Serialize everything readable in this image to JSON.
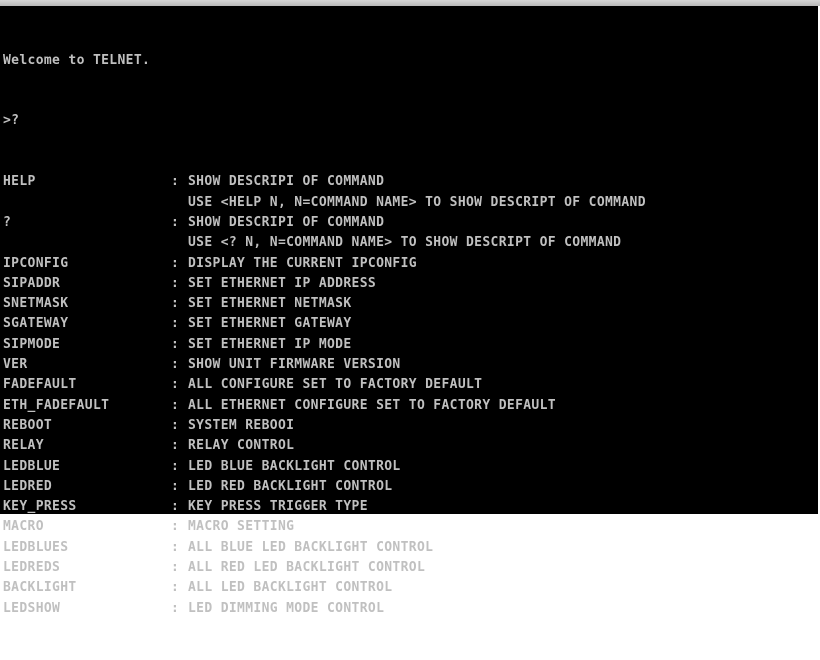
{
  "terminal": {
    "banner": "Welcome to TELNET.",
    "prompt": ">?",
    "separator": ":",
    "commands": [
      {
        "name": "HELP",
        "desc": "SHOW DESCRIPI OF COMMAND"
      },
      {
        "name": "",
        "desc": "USE <HELP N, N=COMMAND NAME> TO SHOW DESCRIPT OF COMMAND"
      },
      {
        "name": "?",
        "desc": "SHOW DESCRIPI OF COMMAND"
      },
      {
        "name": "",
        "desc": "USE <? N, N=COMMAND NAME> TO SHOW DESCRIPT OF COMMAND"
      },
      {
        "name": "IPCONFIG",
        "desc": "DISPLAY THE CURRENT IPCONFIG"
      },
      {
        "name": "SIPADDR",
        "desc": "SET ETHERNET IP ADDRESS"
      },
      {
        "name": "SNETMASK",
        "desc": "SET ETHERNET NETMASK"
      },
      {
        "name": "SGATEWAY",
        "desc": "SET ETHERNET GATEWAY"
      },
      {
        "name": "SIPMODE",
        "desc": "SET ETHERNET IP MODE"
      },
      {
        "name": "VER",
        "desc": "SHOW UNIT FIRMWARE VERSION"
      },
      {
        "name": "FADEFAULT",
        "desc": "ALL CONFIGURE SET TO FACTORY DEFAULT"
      },
      {
        "name": "ETH_FADEFAULT",
        "desc": "ALL ETHERNET CONFIGURE SET TO FACTORY DEFAULT"
      },
      {
        "name": "REBOOT",
        "desc": "SYSTEM REBOOI"
      },
      {
        "name": "RELAY",
        "desc": "RELAY CONTROL"
      },
      {
        "name": "LEDBLUE",
        "desc": "LED BLUE BACKLIGHT CONTROL"
      },
      {
        "name": "LEDRED",
        "desc": "LED RED BACKLIGHT CONTROL"
      },
      {
        "name": "KEY_PRESS",
        "desc": "KEY PRESS TRIGGER TYPE"
      },
      {
        "name": "MACRO",
        "desc": "MACRO SETTING"
      },
      {
        "name": "LEDBLUES",
        "desc": "ALL BLUE LED BACKLIGHT CONTROL"
      },
      {
        "name": "LEDREDS",
        "desc": "ALL RED LED BACKLIGHT CONTROL"
      },
      {
        "name": "BACKLIGHT",
        "desc": "ALL LED BACKLIGHT CONTROL"
      },
      {
        "name": "LEDSHOW",
        "desc": "LED DIMMING MODE CONTROL"
      }
    ]
  },
  "colors": {
    "background": "#000000",
    "text": "#c0c0c0"
  }
}
